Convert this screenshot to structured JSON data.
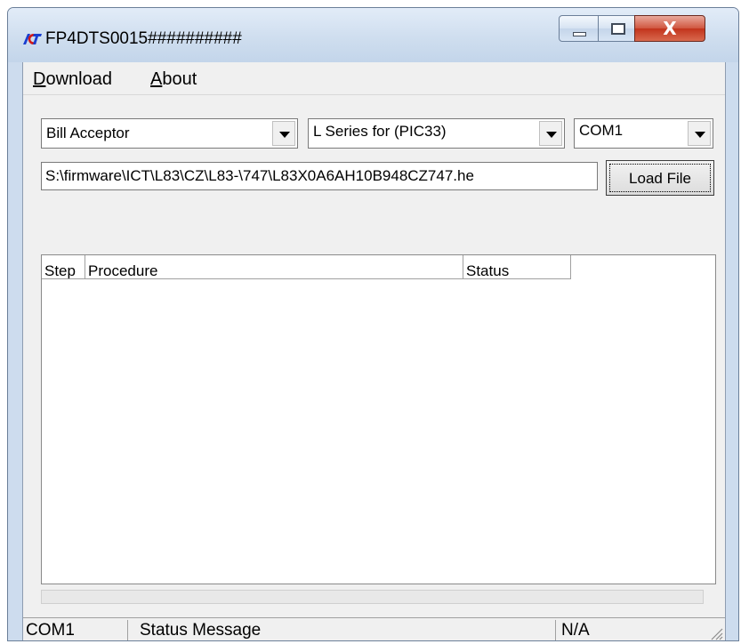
{
  "window": {
    "title": "FP4DTS0015##########",
    "close_glyph": "X"
  },
  "menu": {
    "download": {
      "accel": "D",
      "rest": "ownload"
    },
    "about": {
      "accel": "A",
      "rest": "bout"
    }
  },
  "controls": {
    "device_type": "Bill Acceptor",
    "series": "L Series for (PIC33)",
    "port": "COM1",
    "file_path": "S:\\firmware\\ICT\\L83\\CZ\\L83-\\747\\L83X0A6AH10B948CZ747.he",
    "load_button": "Load File"
  },
  "list": {
    "columns": [
      "Step",
      "Procedure",
      "Status"
    ]
  },
  "statusbar": {
    "port": "COM1",
    "message": "Status Message",
    "value": "N/A"
  },
  "colors": {
    "frame": "#cddcee",
    "client": "#f0f0f0",
    "close_button": "#c2331c"
  },
  "icons": {
    "app": "ict-logo-icon",
    "minimize": "minimize-icon",
    "maximize": "maximize-icon",
    "close": "close-icon",
    "dropdown": "chevron-down-icon",
    "grip": "resize-grip-icon"
  }
}
